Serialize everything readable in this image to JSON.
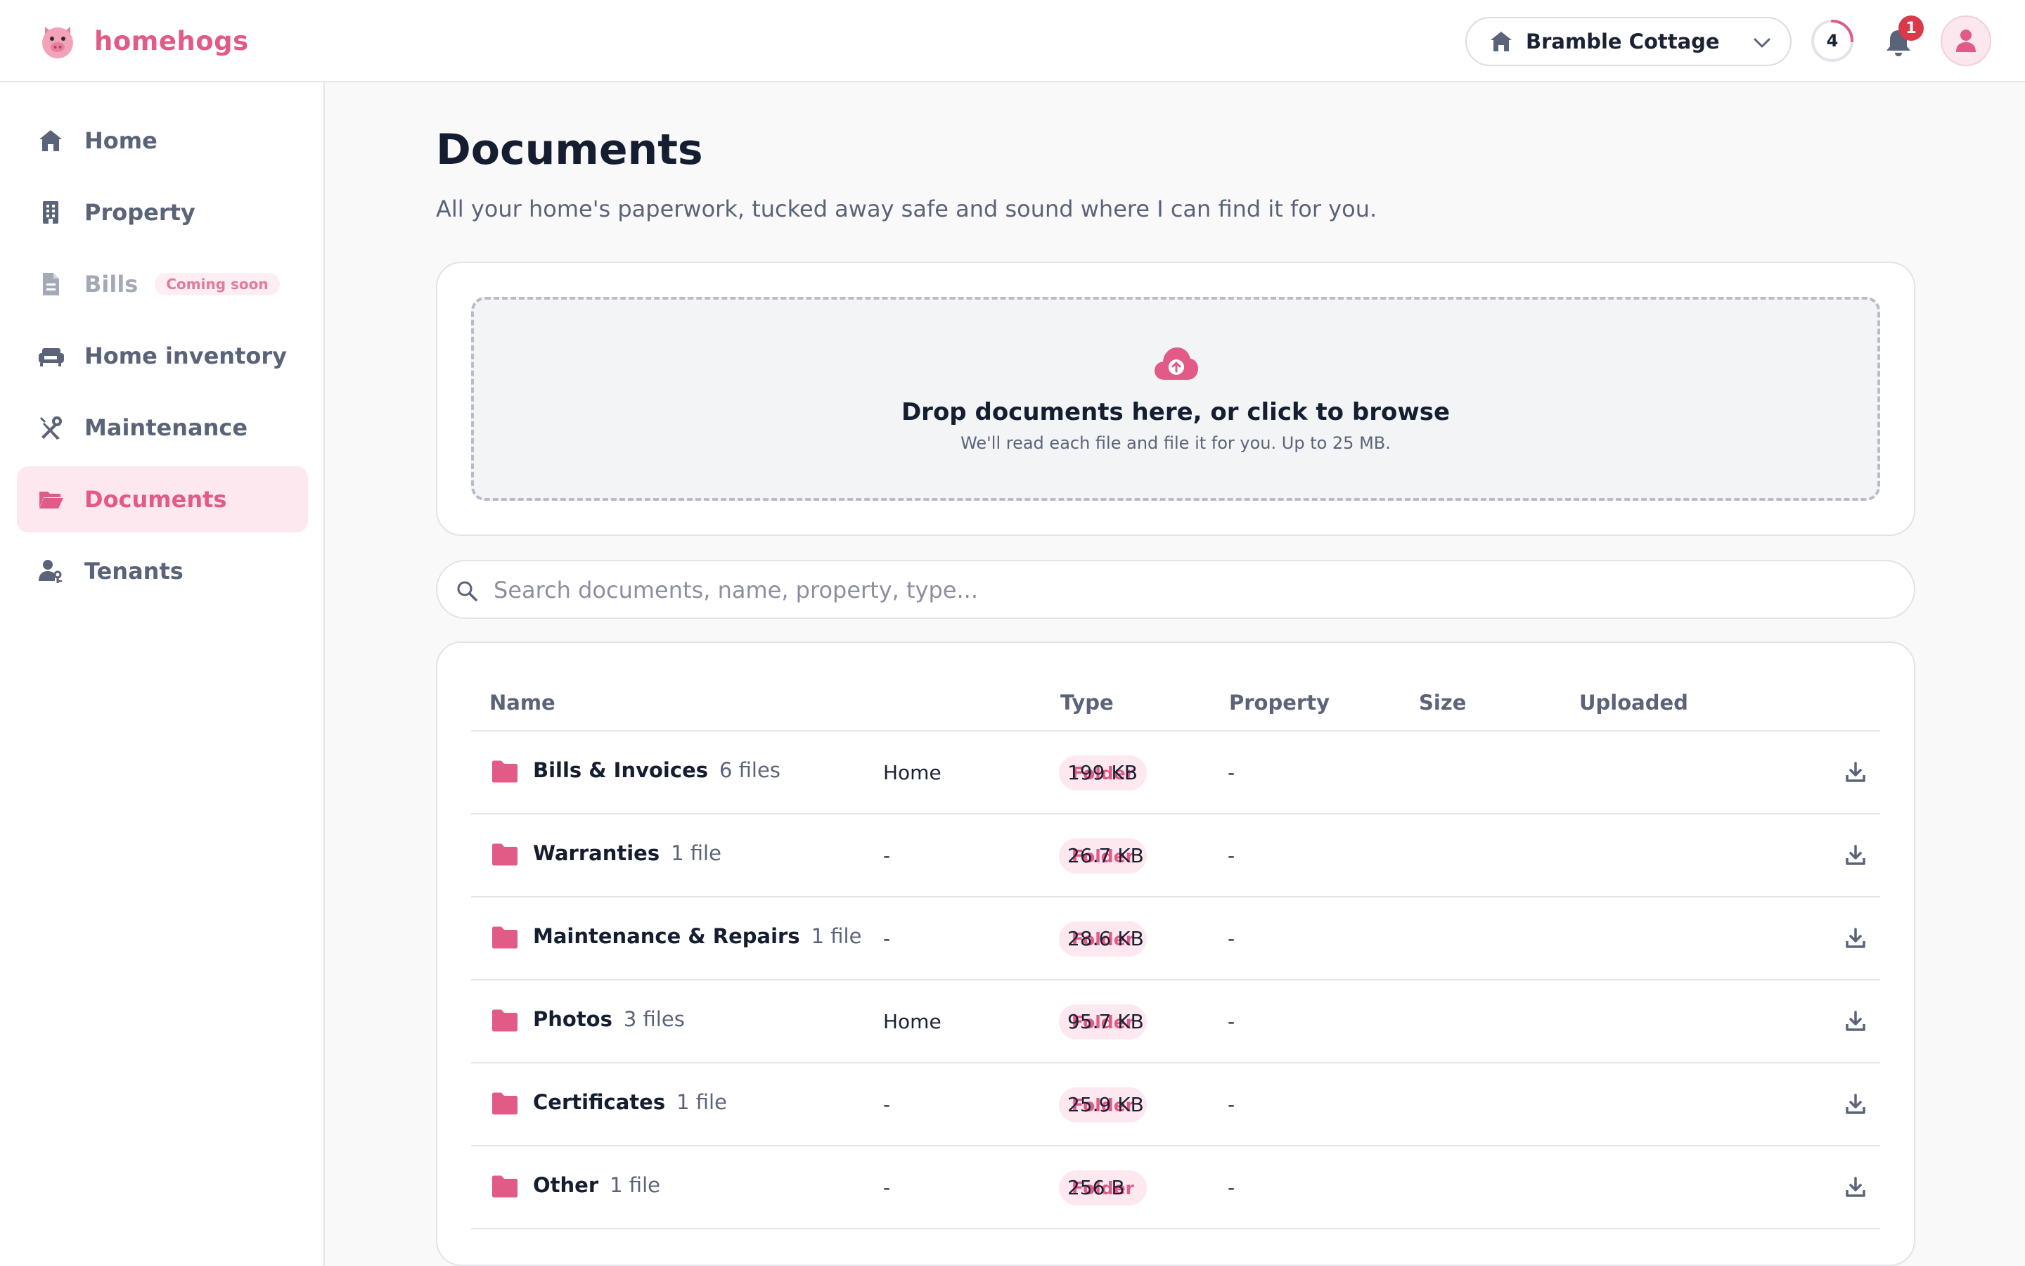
{
  "app": {
    "name": "homehogs"
  },
  "header": {
    "property_selector": "Bramble Cottage",
    "progress_count": "4",
    "progress_fraction": 0.25,
    "notification_count": "1"
  },
  "sidebar": {
    "items": [
      {
        "label": "Home",
        "icon": "home-icon"
      },
      {
        "label": "Property",
        "icon": "building-icon"
      },
      {
        "label": "Bills",
        "icon": "bill-icon",
        "badge": "Coming soon"
      },
      {
        "label": "Home inventory",
        "icon": "couch-icon"
      },
      {
        "label": "Maintenance",
        "icon": "tools-icon"
      },
      {
        "label": "Documents",
        "icon": "folder-open-icon"
      },
      {
        "label": "Tenants",
        "icon": "tenant-icon"
      }
    ],
    "active": "Documents"
  },
  "main": {
    "title": "Documents",
    "subtitle": "All your home's paperwork, tucked away safe and sound where I can find it for you.",
    "upload": {
      "title": "Drop documents here, or click to browse",
      "subtitle": "We'll read each file and file it for you. Up to 25 MB."
    },
    "search": {
      "placeholder": "Search documents, name, property, type..."
    },
    "table": {
      "columns": [
        "Name",
        "Type",
        "Property",
        "Size",
        "Uploaded"
      ],
      "rows": [
        {
          "name": "Bills & Invoices",
          "count": "6 files",
          "type": "Folder",
          "property": "Home",
          "size": "199 KB",
          "uploaded": "-"
        },
        {
          "name": "Warranties",
          "count": "1 file",
          "type": "Folder",
          "property": "-",
          "size": "26.7 KB",
          "uploaded": "-"
        },
        {
          "name": "Maintenance & Repairs",
          "count": "1 file",
          "type": "Folder",
          "property": "-",
          "size": "28.6 KB",
          "uploaded": "-"
        },
        {
          "name": "Photos",
          "count": "3 files",
          "type": "Folder",
          "property": "Home",
          "size": "95.7 KB",
          "uploaded": "-"
        },
        {
          "name": "Certificates",
          "count": "1 file",
          "type": "Folder",
          "property": "-",
          "size": "25.9 KB",
          "uploaded": "-"
        },
        {
          "name": "Other",
          "count": "1 file",
          "type": "Folder",
          "property": "-",
          "size": "256 B",
          "uploaded": "-"
        }
      ]
    }
  },
  "colors": {
    "accent": "#e25a86",
    "accent_soft": "#fde8ef",
    "text_dark": "#151d30",
    "text_muted": "#5a6378",
    "alert": "#d93a4a"
  }
}
